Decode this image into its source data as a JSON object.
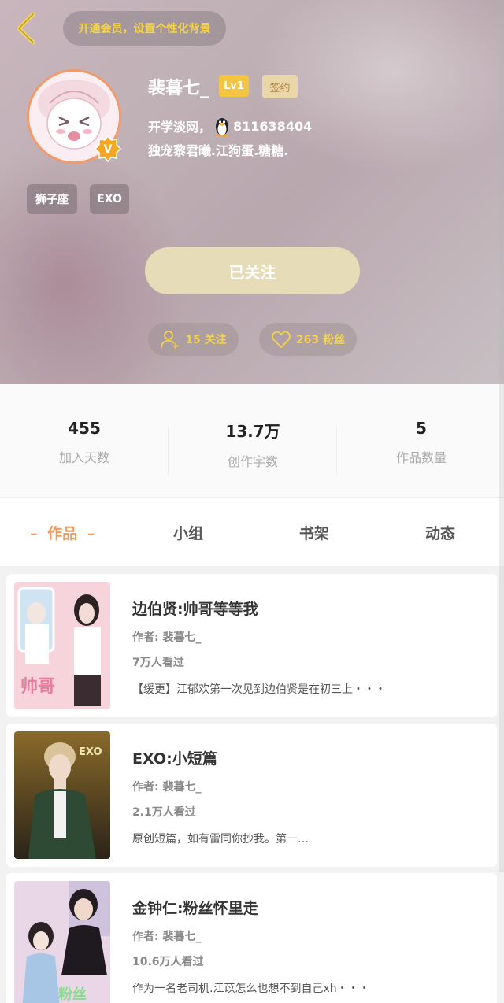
{
  "header": {
    "bg_button_label": "开通会员，设置个性化背景",
    "username": "裴暮七_",
    "level": "Lv1",
    "sign_badge": "签约",
    "bio_line1_prefix": "开学淡网，",
    "bio_line1_qq": "811638404",
    "bio_line2": "独宠黎君曦.江狗蛋.糖糖.",
    "tags": [
      "狮子座",
      "EXO"
    ],
    "follow_button": "已关注",
    "following_label": "15 关注",
    "fans_label": "263 粉丝"
  },
  "stats": [
    {
      "num": "455",
      "label": "加入天数"
    },
    {
      "num": "13.7万",
      "label": "创作字数"
    },
    {
      "num": "5",
      "label": "作品数量"
    }
  ],
  "tabs": [
    {
      "label": "作品",
      "active": true
    },
    {
      "label": "小组",
      "active": false
    },
    {
      "label": "书架",
      "active": false
    },
    {
      "label": "动态",
      "active": false
    }
  ],
  "works": [
    {
      "title": "边伯贤:帅哥等等我",
      "author": "作者: 裴暮七_",
      "views": "7万人看过",
      "desc": "【缓更】江郁欢第一次见到边伯贤是在初三上・・・"
    },
    {
      "title": "EXO:小短篇",
      "author": "作者: 裴暮七_",
      "views": "2.1万人看过",
      "desc": "原创短篇，如有雷同你抄我。第一…"
    },
    {
      "title": "金钟仁:粉丝怀里走",
      "author": "作者: 裴暮七_",
      "views": "10.6万人看过",
      "desc": "作为一名老司机.江苡怎么也想不到自己xh・・・"
    }
  ],
  "colors": {
    "accent_yellow": "#f5d34a",
    "active_tab": "#f49b5c",
    "follow_button_bg": "#e7dcb8"
  }
}
